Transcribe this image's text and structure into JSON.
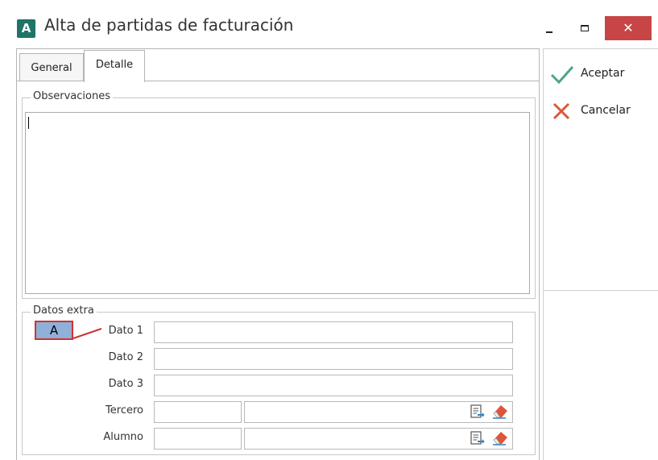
{
  "window": {
    "app_icon_letter": "A",
    "title": "Alta de partidas de facturación",
    "close_glyph": "✕"
  },
  "tabs": [
    {
      "label": "General",
      "selected": false
    },
    {
      "label": "Detalle",
      "selected": true
    }
  ],
  "observaciones": {
    "legend": "Observaciones",
    "value": ""
  },
  "datos_extra": {
    "legend": "Datos extra",
    "fields": [
      {
        "label": "Dato 1",
        "value": ""
      },
      {
        "label": "Dato 2",
        "value": ""
      },
      {
        "label": "Dato 3",
        "value": ""
      }
    ],
    "lookups": [
      {
        "label": "Tercero",
        "code": "",
        "name": ""
      },
      {
        "label": "Alumno",
        "code": "",
        "name": ""
      }
    ]
  },
  "callout": {
    "label": "A"
  },
  "actions": {
    "accept_label": "Aceptar",
    "cancel_label": "Cancelar"
  },
  "colors": {
    "accent_icon": "#1e7467",
    "close_button": "#c74545",
    "accept_check": "#4aa882",
    "cancel_x": "#e0553a",
    "callout_fill": "#8fb0d9",
    "callout_border": "#d23131"
  },
  "icons": {
    "app": "app-logo-icon",
    "accept": "checkmark-icon",
    "cancel": "x-icon",
    "lookup_pick": "document-arrow-icon",
    "lookup_clear": "eraser-icon"
  }
}
